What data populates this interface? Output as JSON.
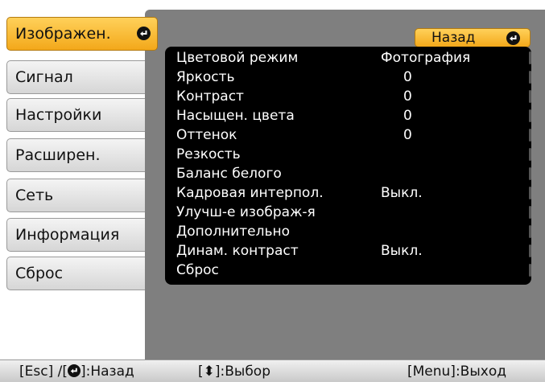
{
  "sidebar": {
    "items": [
      {
        "label": "Изображен."
      },
      {
        "label": "Сигнал"
      },
      {
        "label": "Настройки"
      },
      {
        "label": "Расширен."
      },
      {
        "label": "Сеть"
      },
      {
        "label": "Информация"
      },
      {
        "label": "Сброс"
      }
    ]
  },
  "back_button": {
    "label": "Назад"
  },
  "menu": {
    "rows": [
      {
        "label": "Цветовой режим",
        "value": "Фотография"
      },
      {
        "label": "Яркость",
        "value": "0"
      },
      {
        "label": "Контраст",
        "value": "0"
      },
      {
        "label": "Насыщен. цвета",
        "value": "0"
      },
      {
        "label": "Оттенок",
        "value": "0"
      },
      {
        "label": "Резкость",
        "value": ""
      },
      {
        "label": "Баланс белого",
        "value": ""
      },
      {
        "label": "Кадровая интерпол.",
        "value": "Выкл."
      },
      {
        "label": "Улучш-е изображ-я",
        "value": ""
      },
      {
        "label": "Дополнительно",
        "value": ""
      },
      {
        "label": "Динам. контраст",
        "value": "Выкл."
      },
      {
        "label": "Сброс",
        "value": ""
      }
    ]
  },
  "footer": {
    "back_prefix": "[Esc] /[",
    "back_suffix": "]:Назад",
    "select_hint": "[⬍]:Выбор",
    "exit_hint": "[Menu]:Выход"
  },
  "colors": {
    "accent": "#f3a81a",
    "panel": "#7f7f7f",
    "list_bg": "#000000"
  }
}
